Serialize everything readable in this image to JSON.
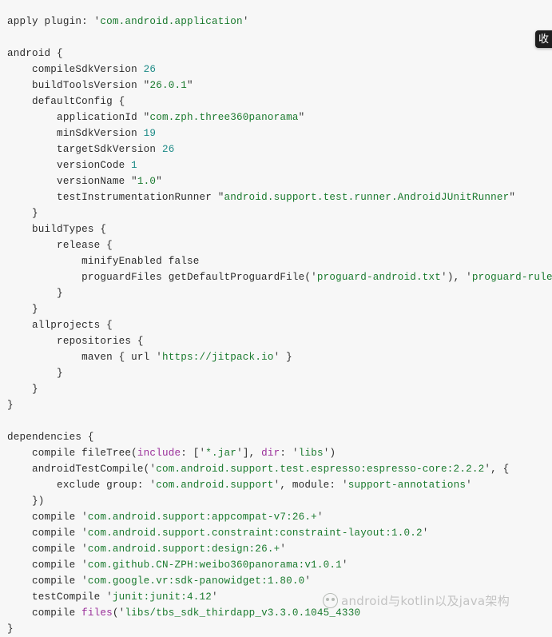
{
  "document": {
    "kind": "source-code-screenshot",
    "language": "gradle",
    "filename_implied": "build.gradle",
    "background_color": "#f7f7f7",
    "colors": {
      "plain_text": "#2b2b2b",
      "string": "#1a7a2e",
      "number": "#1d8a86",
      "named_argument": "#9a2f9a",
      "function": "#9a2f9a",
      "button_background": "#1f1f1f",
      "watermark_text": "#7b7b7b"
    }
  },
  "code": {
    "lines": [
      [
        {
          "t": "apply plugin: ",
          "c": "plain"
        },
        {
          "t": "'",
          "c": "quote"
        },
        {
          "t": "com.android.application",
          "c": "str"
        },
        {
          "t": "'",
          "c": "quote"
        }
      ],
      [],
      [
        {
          "t": "android {",
          "c": "plain"
        }
      ],
      [
        {
          "t": "    compileSdkVersion ",
          "c": "plain"
        },
        {
          "t": "26",
          "c": "num"
        }
      ],
      [
        {
          "t": "    buildToolsVersion ",
          "c": "plain"
        },
        {
          "t": "\"",
          "c": "quote"
        },
        {
          "t": "26.0.1",
          "c": "str"
        },
        {
          "t": "\"",
          "c": "quote"
        }
      ],
      [
        {
          "t": "    defaultConfig {",
          "c": "plain"
        }
      ],
      [
        {
          "t": "        applicationId ",
          "c": "plain"
        },
        {
          "t": "\"",
          "c": "quote"
        },
        {
          "t": "com.zph.three360panorama",
          "c": "str"
        },
        {
          "t": "\"",
          "c": "quote"
        }
      ],
      [
        {
          "t": "        minSdkVersion ",
          "c": "plain"
        },
        {
          "t": "19",
          "c": "num"
        }
      ],
      [
        {
          "t": "        targetSdkVersion ",
          "c": "plain"
        },
        {
          "t": "26",
          "c": "num"
        }
      ],
      [
        {
          "t": "        versionCode ",
          "c": "plain"
        },
        {
          "t": "1",
          "c": "num"
        }
      ],
      [
        {
          "t": "        versionName ",
          "c": "plain"
        },
        {
          "t": "\"",
          "c": "quote"
        },
        {
          "t": "1.0",
          "c": "str"
        },
        {
          "t": "\"",
          "c": "quote"
        }
      ],
      [
        {
          "t": "        testInstrumentationRunner ",
          "c": "plain"
        },
        {
          "t": "\"",
          "c": "quote"
        },
        {
          "t": "android.support.test.runner.AndroidJUnitRunner",
          "c": "str"
        },
        {
          "t": "\"",
          "c": "quote"
        }
      ],
      [
        {
          "t": "    }",
          "c": "plain"
        }
      ],
      [
        {
          "t": "    buildTypes {",
          "c": "plain"
        }
      ],
      [
        {
          "t": "        release {",
          "c": "plain"
        }
      ],
      [
        {
          "t": "            minifyEnabled false",
          "c": "plain"
        }
      ],
      [
        {
          "t": "            proguardFiles getDefaultProguardFile(",
          "c": "plain"
        },
        {
          "t": "'",
          "c": "quote"
        },
        {
          "t": "proguard-android.txt",
          "c": "str"
        },
        {
          "t": "'",
          "c": "quote"
        },
        {
          "t": "), ",
          "c": "plain"
        },
        {
          "t": "'",
          "c": "quote"
        },
        {
          "t": "proguard-rules.pro",
          "c": "str"
        },
        {
          "t": "'",
          "c": "quote"
        }
      ],
      [
        {
          "t": "        }",
          "c": "plain"
        }
      ],
      [
        {
          "t": "    }",
          "c": "plain"
        }
      ],
      [
        {
          "t": "    allprojects {",
          "c": "plain"
        }
      ],
      [
        {
          "t": "        repositories {",
          "c": "plain"
        }
      ],
      [
        {
          "t": "            maven { url ",
          "c": "plain"
        },
        {
          "t": "'",
          "c": "quote"
        },
        {
          "t": "https://jitpack.io",
          "c": "str"
        },
        {
          "t": "'",
          "c": "quote"
        },
        {
          "t": " }",
          "c": "plain"
        }
      ],
      [
        {
          "t": "        }",
          "c": "plain"
        }
      ],
      [
        {
          "t": "    }",
          "c": "plain"
        }
      ],
      [
        {
          "t": "}",
          "c": "plain"
        }
      ],
      [],
      [
        {
          "t": "dependencies {",
          "c": "plain"
        }
      ],
      [
        {
          "t": "    compile fileTree(",
          "c": "plain"
        },
        {
          "t": "include",
          "c": "arg"
        },
        {
          "t": ": [",
          "c": "plain"
        },
        {
          "t": "'",
          "c": "quote"
        },
        {
          "t": "*.jar",
          "c": "str"
        },
        {
          "t": "'",
          "c": "quote"
        },
        {
          "t": "], ",
          "c": "plain"
        },
        {
          "t": "dir",
          "c": "arg"
        },
        {
          "t": ": ",
          "c": "plain"
        },
        {
          "t": "'",
          "c": "quote"
        },
        {
          "t": "libs",
          "c": "str"
        },
        {
          "t": "'",
          "c": "quote"
        },
        {
          "t": ")",
          "c": "plain"
        }
      ],
      [
        {
          "t": "    androidTestCompile(",
          "c": "plain"
        },
        {
          "t": "'",
          "c": "quote"
        },
        {
          "t": "com.android.support.test.espresso:espresso-core:2.2.2",
          "c": "str"
        },
        {
          "t": "'",
          "c": "quote"
        },
        {
          "t": ", {",
          "c": "plain"
        }
      ],
      [
        {
          "t": "        exclude group: ",
          "c": "plain"
        },
        {
          "t": "'",
          "c": "quote"
        },
        {
          "t": "com.android.support",
          "c": "str"
        },
        {
          "t": "'",
          "c": "quote"
        },
        {
          "t": ", module: ",
          "c": "plain"
        },
        {
          "t": "'",
          "c": "quote"
        },
        {
          "t": "support-annotations",
          "c": "str"
        },
        {
          "t": "'",
          "c": "quote"
        }
      ],
      [
        {
          "t": "    })",
          "c": "plain"
        }
      ],
      [
        {
          "t": "    compile ",
          "c": "plain"
        },
        {
          "t": "'",
          "c": "quote"
        },
        {
          "t": "com.android.support:appcompat-v7:26.+",
          "c": "str"
        },
        {
          "t": "'",
          "c": "quote"
        }
      ],
      [
        {
          "t": "    compile ",
          "c": "plain"
        },
        {
          "t": "'",
          "c": "quote"
        },
        {
          "t": "com.android.support.constraint:constraint-layout:1.0.2",
          "c": "str"
        },
        {
          "t": "'",
          "c": "quote"
        }
      ],
      [
        {
          "t": "    compile ",
          "c": "plain"
        },
        {
          "t": "'",
          "c": "quote"
        },
        {
          "t": "com.android.support:design:26.+",
          "c": "str"
        },
        {
          "t": "'",
          "c": "quote"
        }
      ],
      [
        {
          "t": "    compile ",
          "c": "plain"
        },
        {
          "t": "'",
          "c": "quote"
        },
        {
          "t": "com.github.CN-ZPH:weibo360panorama:v1.0.1",
          "c": "str"
        },
        {
          "t": "'",
          "c": "quote"
        }
      ],
      [
        {
          "t": "    compile ",
          "c": "plain"
        },
        {
          "t": "'",
          "c": "quote"
        },
        {
          "t": "com.google.vr:sdk-panowidget:1.80.0",
          "c": "str"
        },
        {
          "t": "'",
          "c": "quote"
        }
      ],
      [
        {
          "t": "    testCompile ",
          "c": "plain"
        },
        {
          "t": "'",
          "c": "quote"
        },
        {
          "t": "junit:junit:4.12",
          "c": "str"
        },
        {
          "t": "'",
          "c": "quote"
        }
      ],
      [
        {
          "t": "    compile ",
          "c": "plain"
        },
        {
          "t": "files",
          "c": "fn"
        },
        {
          "t": "(",
          "c": "plain"
        },
        {
          "t": "'",
          "c": "quote"
        },
        {
          "t": "libs/tbs_sdk_thirdapp_v3.3.0.1045_4330",
          "c": "str"
        }
      ],
      [
        {
          "t": "}",
          "c": "plain"
        }
      ]
    ]
  },
  "overlay": {
    "collapse_button": {
      "label": "收",
      "title": "收"
    },
    "watermark": {
      "logo_icon": "panda-face-icon",
      "text": "android与kotlin以及java架构"
    }
  }
}
